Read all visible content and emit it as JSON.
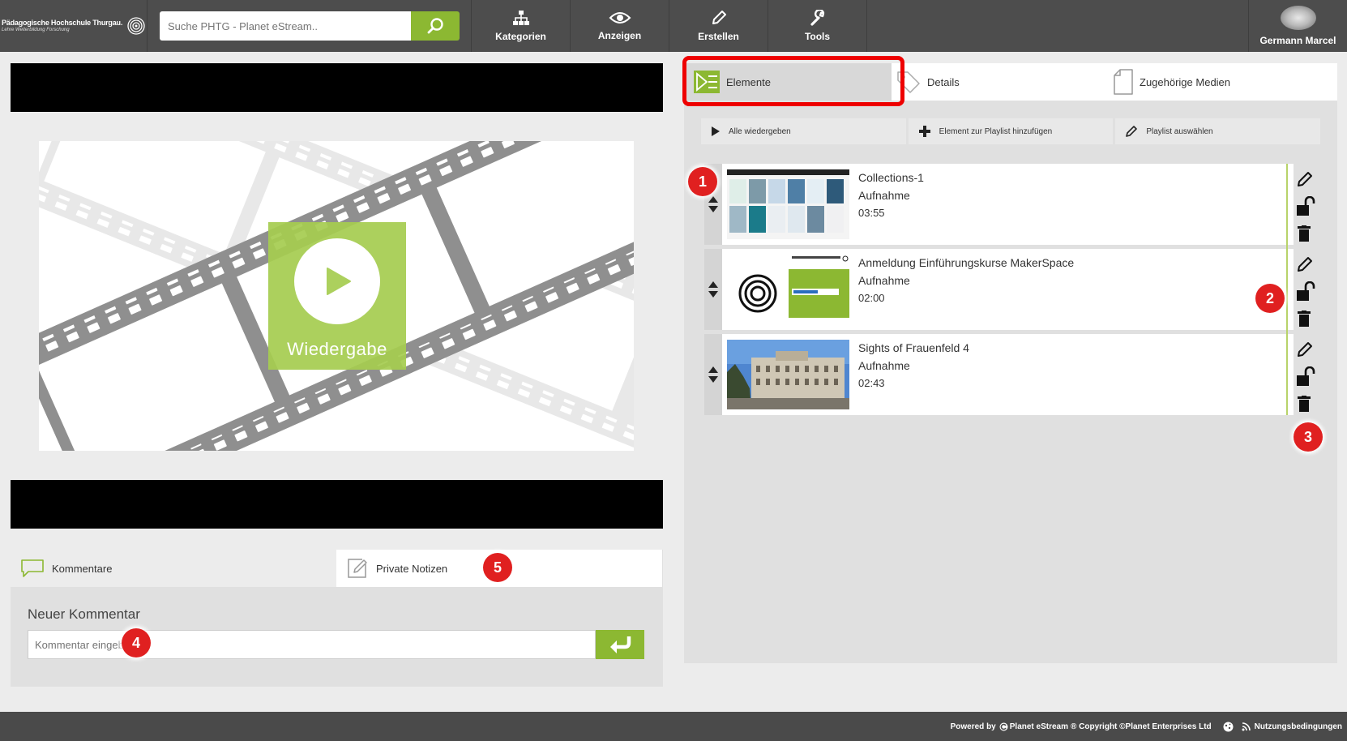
{
  "header": {
    "logo_title": "Pädagogische Hochschule Thurgau.",
    "logo_sub": "Lehre Weiterbildung Forschung",
    "search_placeholder": "Suche PHTG - Planet eStream..",
    "nav": [
      {
        "label": "Kategorien",
        "icon": "sitemap-icon"
      },
      {
        "label": "Anzeigen",
        "icon": "eye-icon"
      },
      {
        "label": "Erstellen",
        "icon": "pencil-icon"
      },
      {
        "label": "Tools",
        "icon": "wrench-icon"
      }
    ],
    "user_name": "Germann Marcel"
  },
  "player": {
    "play_label": "Wiedergabe"
  },
  "comments": {
    "tabs": [
      {
        "label": "Kommentare",
        "icon": "speech-bubble-icon",
        "active": true
      },
      {
        "label": "Private Notizen",
        "icon": "note-edit-icon",
        "active": false
      }
    ],
    "new_title": "Neuer Kommentar",
    "input_placeholder": "Kommentar eingeben"
  },
  "right": {
    "tabs": [
      {
        "label": "Elemente",
        "icon": "playlist-icon"
      },
      {
        "label": "Details",
        "icon": "tag-icon"
      },
      {
        "label": "Zugehörige Medien",
        "icon": "document-icon"
      }
    ],
    "actions": [
      {
        "label": "Alle wiedergeben",
        "icon": "play-icon"
      },
      {
        "label": "Element zur Playlist hinzufügen",
        "icon": "plus-icon"
      },
      {
        "label": "Playlist auswählen",
        "icon": "pencil-icon"
      }
    ],
    "items": [
      {
        "title": "Collections-1",
        "type": "Aufnahme",
        "duration": "03:55"
      },
      {
        "title": "Anmeldung Einführungskurse MakerSpace",
        "type": "Aufnahme",
        "duration": "02:00"
      },
      {
        "title": "Sights of Frauenfeld 4",
        "type": "Aufnahme",
        "duration": "02:43"
      }
    ]
  },
  "badges": [
    "1",
    "2",
    "3",
    "4",
    "5"
  ],
  "footer": {
    "powered_by": "Powered by",
    "brand": "Planet eStream",
    "copyright": "® Copyright ©Planet Enterprises Ltd",
    "terms": "Nutzungsbedingungen"
  },
  "colors": {
    "accent": "#8cb832",
    "header_bg": "#4d4d4d",
    "highlight": "#e00000",
    "badge": "#e02020"
  }
}
